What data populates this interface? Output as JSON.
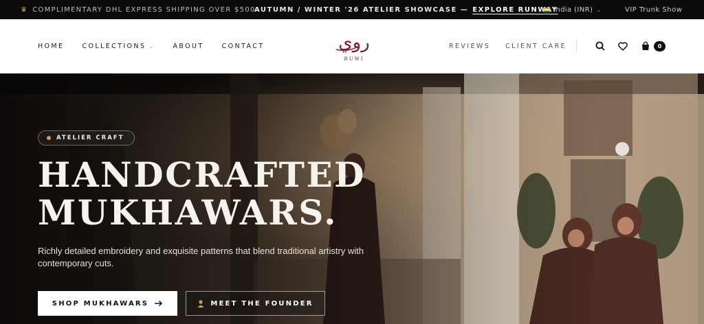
{
  "announcement": {
    "shipping_text": "COMPLIMENTARY DHL EXPRESS SHIPPING OVER $500",
    "showcase_text": "AUTUMN / WINTER '26 ATELIER SHOWCASE —",
    "showcase_link": "EXPLORE RUNWAY",
    "region": "India (INR)",
    "vip_link": "VIP Trunk Show"
  },
  "nav": {
    "home": "HOME",
    "collections": "COLLECTIONS",
    "about": "ABOUT",
    "contact": "CONTACT",
    "reviews": "REVIEWS",
    "client_care": "CLIENT CARE",
    "cart_count": "0"
  },
  "logo": {
    "arabic": "روي",
    "latin": "RUWI"
  },
  "hero": {
    "badge": "ATELIER CRAFT",
    "title_line1": "HANDCRAFTED",
    "title_line2": "MUKHAWARS.",
    "subtitle": "Richly detailed embroidery and exquisite patterns that blend traditional artistry with contemporary cuts.",
    "primary_cta": "SHOP MUKHAWARS",
    "secondary_cta": "MEET THE FOUNDER"
  },
  "colors": {
    "accent_gold": "#c4952f",
    "logo_red": "#7a1f2b",
    "topbar_bg": "#0b0b0b"
  }
}
